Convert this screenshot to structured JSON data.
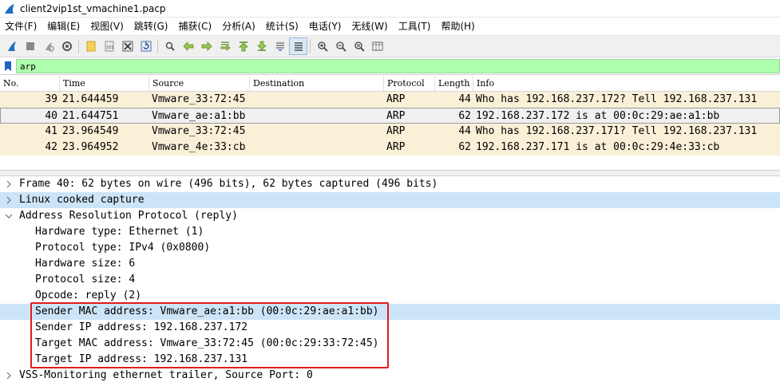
{
  "window": {
    "title": "client2vip1st_vmachine1.pacp"
  },
  "menu": {
    "items": [
      "文件(F)",
      "编辑(E)",
      "视图(V)",
      "跳转(G)",
      "捕获(C)",
      "分析(A)",
      "统计(S)",
      "电话(Y)",
      "无线(W)",
      "工具(T)",
      "帮助(H)"
    ]
  },
  "toolbar": {
    "icons": [
      "start-capture",
      "stop-capture",
      "restart-capture",
      "capture-options",
      "open-file",
      "save-file",
      "close-file",
      "reload-file",
      "find-packet",
      "go-back",
      "go-forward",
      "go-to-packet",
      "go-first",
      "go-last",
      "auto-scroll",
      "colorize",
      "zoom-in",
      "zoom-out",
      "zoom-normal",
      "resize-columns"
    ]
  },
  "filter": {
    "value": "arp"
  },
  "packet_list": {
    "columns": [
      "No.",
      "Time",
      "Source",
      "Destination",
      "Protocol",
      "Length",
      "Info"
    ],
    "rows": [
      {
        "no": "39",
        "time": "21.644459",
        "source": "Vmware_33:72:45",
        "destination": "",
        "protocol": "ARP",
        "length": "44",
        "info": "Who has 192.168.237.172? Tell 192.168.237.131"
      },
      {
        "no": "40",
        "time": "21.644751",
        "source": "Vmware_ae:a1:bb",
        "destination": "",
        "protocol": "ARP",
        "length": "62",
        "info": "192.168.237.172 is at 00:0c:29:ae:a1:bb"
      },
      {
        "no": "41",
        "time": "23.964549",
        "source": "Vmware_33:72:45",
        "destination": "",
        "protocol": "ARP",
        "length": "44",
        "info": "Who has 192.168.237.171? Tell 192.168.237.131"
      },
      {
        "no": "42",
        "time": "23.964952",
        "source": "Vmware_4e:33:cb",
        "destination": "",
        "protocol": "ARP",
        "length": "62",
        "info": "192.168.237.171 is at 00:0c:29:4e:33:cb"
      }
    ]
  },
  "details": {
    "frame": "Frame 40: 62 bytes on wire (496 bits), 62 bytes captured (496 bits)",
    "linux": "Linux cooked capture",
    "arp": "Address Resolution Protocol (reply)",
    "hw_type": "Hardware type: Ethernet (1)",
    "proto_type": "Protocol type: IPv4 (0x0800)",
    "hw_size": "Hardware size: 6",
    "proto_size": "Protocol size: 4",
    "opcode": "Opcode: reply (2)",
    "sender_mac": "Sender MAC address: Vmware_ae:a1:bb (00:0c:29:ae:a1:bb)",
    "sender_ip": "Sender IP address: 192.168.237.172",
    "target_mac": "Target MAC address: Vmware_33:72:45 (00:0c:29:33:72:45)",
    "target_ip": "Target IP address: 192.168.237.131",
    "vss": "VSS-Monitoring ethernet trailer, Source Port: 0"
  },
  "colors": {
    "arp_row": "#faf0d7",
    "filter_ok": "#afffaf",
    "highlight_row": "#cce4f7",
    "annotation_box": "#e21b1b"
  }
}
